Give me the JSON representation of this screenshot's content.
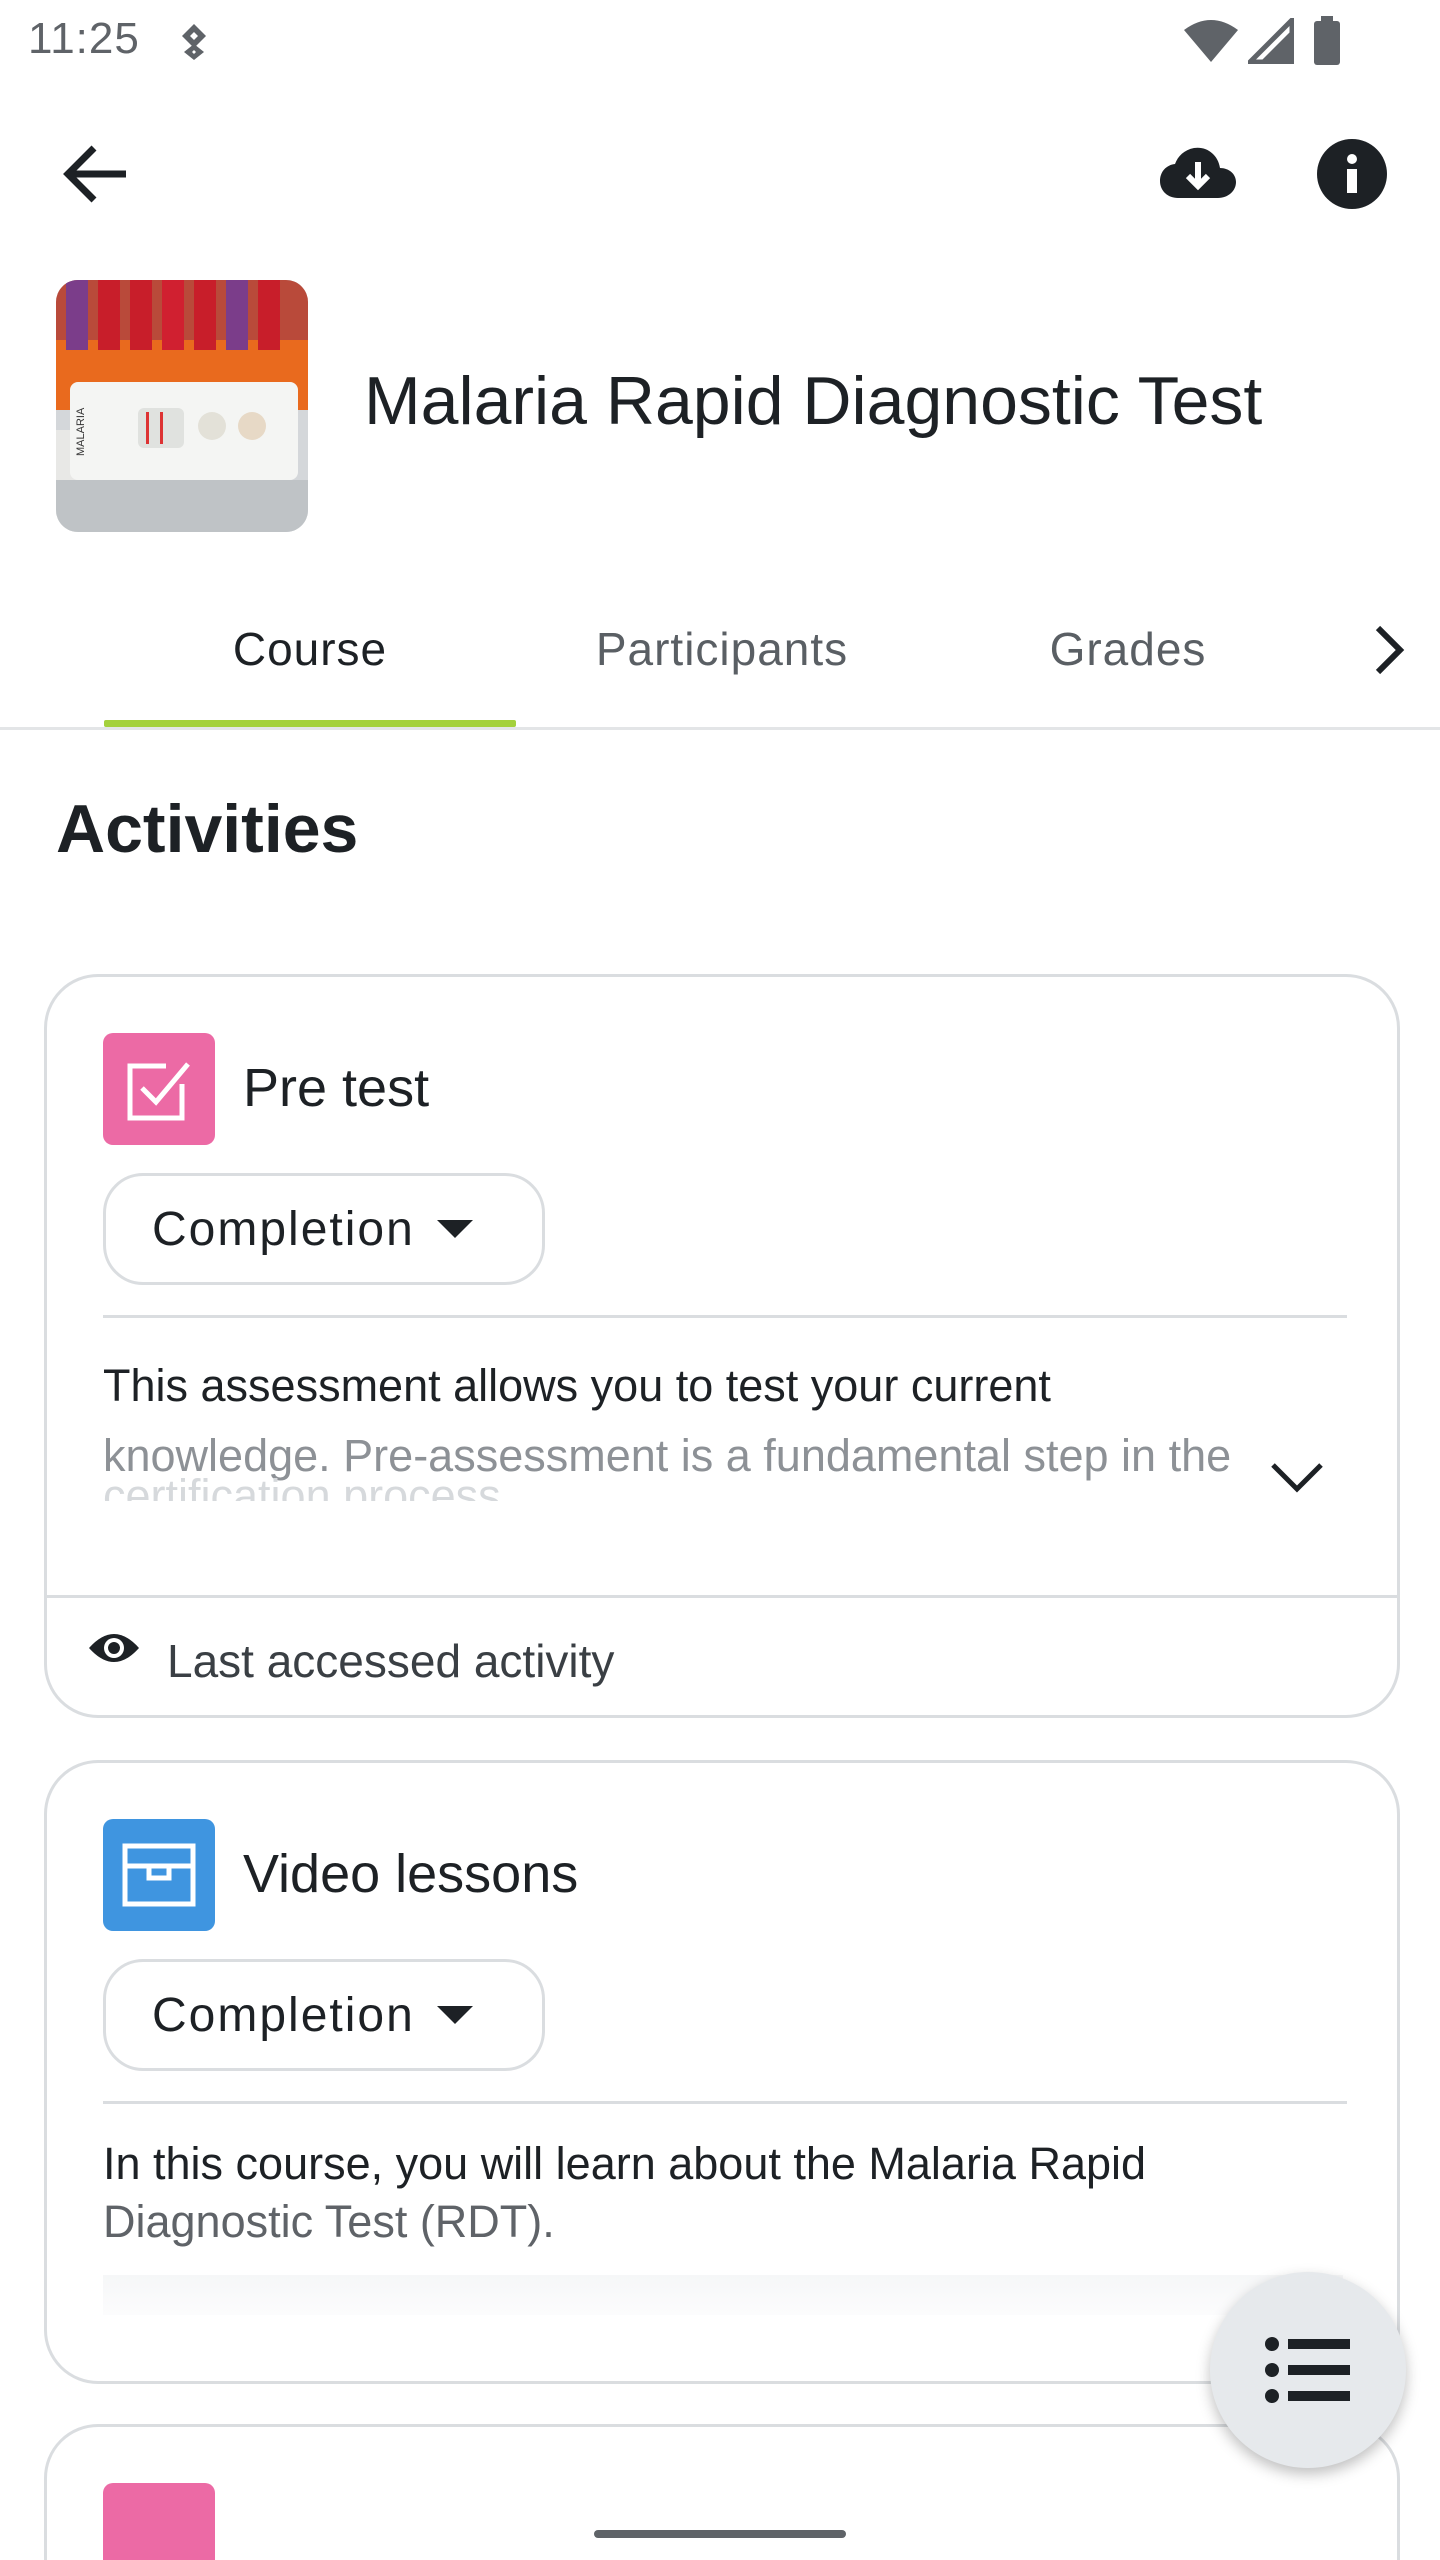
{
  "status_bar": {
    "time": "11:25"
  },
  "app_bar": {
    "back_icon": "arrow-back-icon",
    "download_icon": "cloud-download-icon",
    "info_icon": "info-icon"
  },
  "course": {
    "title": "Malaria Rapid Diagnostic Test",
    "image_label": "MALARIA"
  },
  "tabs": [
    {
      "label": "Course",
      "selected": true
    },
    {
      "label": "Participants",
      "selected": false
    },
    {
      "label": "Grades",
      "selected": false
    }
  ],
  "section": {
    "title": "Activities"
  },
  "activities": [
    {
      "title": "Pre test",
      "icon": "checkbox-icon",
      "completion_label": "Completion",
      "description_line1": "This assessment allows you to test your current",
      "description_line2": "knowledge. Pre-assessment is a fundamental step in the",
      "description_line3": "certification process",
      "footer_label": "Last accessed activity"
    },
    {
      "title": "Video lessons",
      "icon": "box-icon",
      "completion_label": "Completion",
      "description_line1": "In this course, you will learn about the Malaria Rapid",
      "description_line2": "Diagnostic Test (RDT)."
    }
  ],
  "colors": {
    "tab_indicator": "#a4d13c",
    "quiz_icon_bg": "#ec6aa5",
    "resource_icon_bg": "#3f95e0"
  }
}
